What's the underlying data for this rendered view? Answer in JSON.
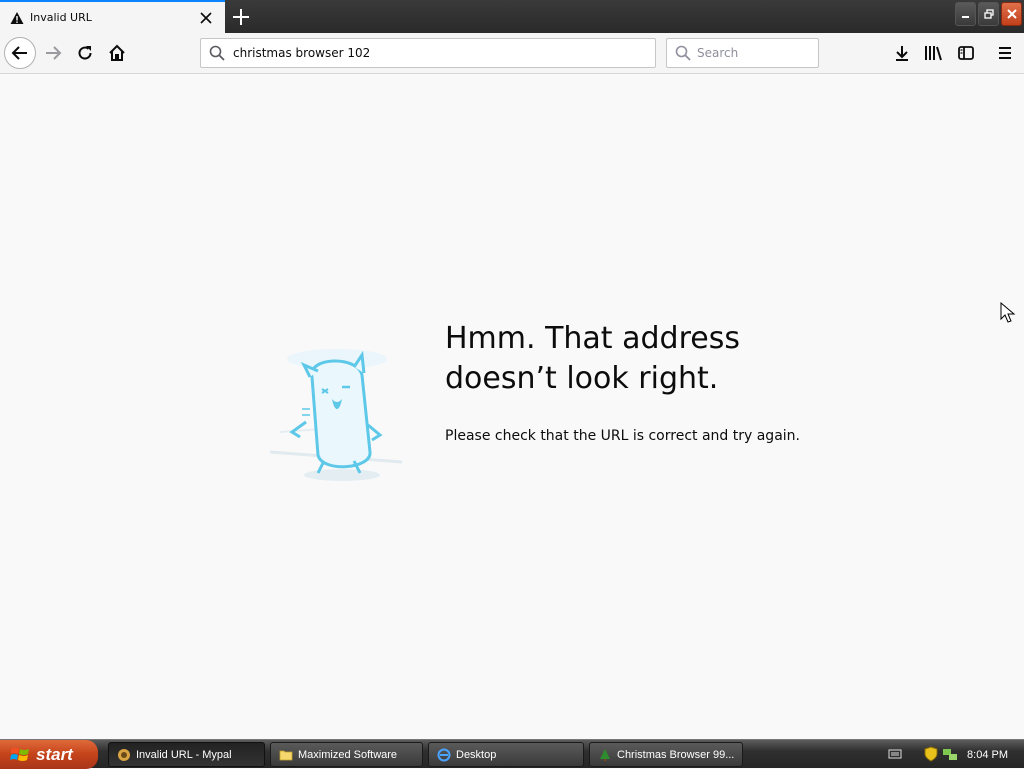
{
  "tab": {
    "title": "Invalid URL"
  },
  "navbar": {
    "url": "christmas browser 102",
    "search_placeholder": "Search"
  },
  "error": {
    "title": "Hmm. That address doesn’t look right.",
    "description": "Please check that the URL is correct and try again."
  },
  "taskbar": {
    "start_label": "start",
    "tasks": [
      {
        "label": "Invalid URL - Mypal",
        "icon": "mypal-icon",
        "active": true
      },
      {
        "label": "Maximized Software",
        "icon": "folder-icon",
        "active": false
      },
      {
        "label": "Desktop",
        "icon": "ie-icon",
        "active": false
      },
      {
        "label": "Christmas Browser 99...",
        "icon": "christmas-tree-icon",
        "active": false
      }
    ],
    "clock": "8:04 PM"
  },
  "colors": {
    "accent": "#0a84ff",
    "start": "#c4431a",
    "illustration": "#5ec8e8"
  }
}
